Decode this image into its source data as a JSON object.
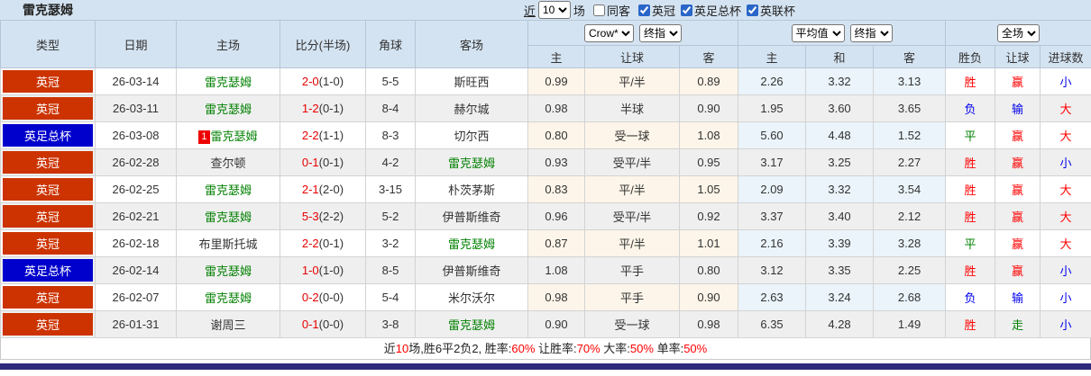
{
  "title": "雷克瑟姆",
  "controls": {
    "recent_label": "近",
    "recent_count": "10",
    "games_label": "场",
    "same_away": {
      "label": "同客",
      "checked": false
    },
    "leagues": [
      {
        "label": "英冠",
        "checked": true
      },
      {
        "label": "英足总杯",
        "checked": true
      },
      {
        "label": "英联杯",
        "checked": true
      }
    ]
  },
  "dropdowns": {
    "bookmaker": "Crow*",
    "asia_stage": "终指",
    "eu_source": "平均值",
    "eu_stage": "终指",
    "scope": "全场"
  },
  "columns": {
    "type": "类型",
    "date": "日期",
    "home": "主场",
    "score": "比分(半场)",
    "corner": "角球",
    "away": "客场",
    "asia_home": "主",
    "asia_line": "让球",
    "asia_away": "客",
    "eu_home": "主",
    "eu_draw": "和",
    "eu_away": "客",
    "res_spf": "胜负",
    "res_handicap": "让球",
    "res_goals": "进球数"
  },
  "colors": {
    "league_red": "#cc3300",
    "league_blue": "#0000cc",
    "team_highlight": "#008000",
    "score_red": "#e60000",
    "header_bg": "#d4e3f1",
    "asia_col_bg": "#fdf5e9",
    "eu_col_bg": "#eaf4fa",
    "bottom_bar": "#2f2a7b"
  },
  "rows": [
    {
      "league": "英冠",
      "league_color": "#cc3300",
      "date": "26-03-14",
      "home": {
        "name": "雷克瑟姆",
        "hl": true
      },
      "score": "2-0",
      "half": "(1-0)",
      "corner": "5-5",
      "away": {
        "name": "斯旺西",
        "hl": false
      },
      "asia": [
        "0.99",
        "平/半",
        "0.89"
      ],
      "europe": [
        "2.26",
        "3.32",
        "3.13"
      ],
      "results": [
        {
          "t": "胜",
          "c": "red"
        },
        {
          "t": "赢",
          "c": "red"
        },
        {
          "t": "小",
          "c": "blue"
        }
      ]
    },
    {
      "league": "英冠",
      "league_color": "#cc3300",
      "date": "26-03-11",
      "home": {
        "name": "雷克瑟姆",
        "hl": true
      },
      "score": "1-2",
      "half": "(0-1)",
      "corner": "8-4",
      "away": {
        "name": "赫尔城",
        "hl": false
      },
      "asia": [
        "0.98",
        "半球",
        "0.90"
      ],
      "europe": [
        "1.95",
        "3.60",
        "3.65"
      ],
      "results": [
        {
          "t": "负",
          "c": "blue"
        },
        {
          "t": "输",
          "c": "blue"
        },
        {
          "t": "大",
          "c": "red"
        }
      ]
    },
    {
      "league": "英足总杯",
      "league_color": "#0000cc",
      "date": "26-03-08",
      "home": {
        "name": "雷克瑟姆",
        "hl": true,
        "rank": "1"
      },
      "score": "2-2",
      "half": "(1-1)",
      "corner": "8-3",
      "away": {
        "name": "切尔西",
        "hl": false
      },
      "asia": [
        "0.80",
        "受一球",
        "1.08"
      ],
      "europe": [
        "5.60",
        "4.48",
        "1.52"
      ],
      "results": [
        {
          "t": "平",
          "c": "green"
        },
        {
          "t": "赢",
          "c": "red"
        },
        {
          "t": "大",
          "c": "red"
        }
      ]
    },
    {
      "league": "英冠",
      "league_color": "#cc3300",
      "date": "26-02-28",
      "home": {
        "name": "查尔顿",
        "hl": false
      },
      "score": "0-1",
      "half": "(0-1)",
      "corner": "4-2",
      "away": {
        "name": "雷克瑟姆",
        "hl": true
      },
      "asia": [
        "0.93",
        "受平/半",
        "0.95"
      ],
      "europe": [
        "3.17",
        "3.25",
        "2.27"
      ],
      "results": [
        {
          "t": "胜",
          "c": "red"
        },
        {
          "t": "赢",
          "c": "red"
        },
        {
          "t": "小",
          "c": "blue"
        }
      ]
    },
    {
      "league": "英冠",
      "league_color": "#cc3300",
      "date": "26-02-25",
      "home": {
        "name": "雷克瑟姆",
        "hl": true
      },
      "score": "2-1",
      "half": "(2-0)",
      "corner": "3-15",
      "away": {
        "name": "朴茨茅斯",
        "hl": false
      },
      "asia": [
        "0.83",
        "平/半",
        "1.05"
      ],
      "europe": [
        "2.09",
        "3.32",
        "3.54"
      ],
      "results": [
        {
          "t": "胜",
          "c": "red"
        },
        {
          "t": "赢",
          "c": "red"
        },
        {
          "t": "大",
          "c": "red"
        }
      ]
    },
    {
      "league": "英冠",
      "league_color": "#cc3300",
      "date": "26-02-21",
      "home": {
        "name": "雷克瑟姆",
        "hl": true
      },
      "score": "5-3",
      "half": "(2-2)",
      "corner": "5-2",
      "away": {
        "name": "伊普斯维奇",
        "hl": false
      },
      "asia": [
        "0.96",
        "受平/半",
        "0.92"
      ],
      "europe": [
        "3.37",
        "3.40",
        "2.12"
      ],
      "results": [
        {
          "t": "胜",
          "c": "red"
        },
        {
          "t": "赢",
          "c": "red"
        },
        {
          "t": "大",
          "c": "red"
        }
      ]
    },
    {
      "league": "英冠",
      "league_color": "#cc3300",
      "date": "26-02-18",
      "home": {
        "name": "布里斯托城",
        "hl": false
      },
      "score": "2-2",
      "half": "(0-1)",
      "corner": "3-2",
      "away": {
        "name": "雷克瑟姆",
        "hl": true
      },
      "asia": [
        "0.87",
        "平/半",
        "1.01"
      ],
      "europe": [
        "2.16",
        "3.39",
        "3.28"
      ],
      "results": [
        {
          "t": "平",
          "c": "green"
        },
        {
          "t": "赢",
          "c": "red"
        },
        {
          "t": "大",
          "c": "red"
        }
      ]
    },
    {
      "league": "英足总杯",
      "league_color": "#0000cc",
      "date": "26-02-14",
      "home": {
        "name": "雷克瑟姆",
        "hl": true
      },
      "score": "1-0",
      "half": "(1-0)",
      "corner": "8-5",
      "away": {
        "name": "伊普斯维奇",
        "hl": false
      },
      "asia": [
        "1.08",
        "平手",
        "0.80"
      ],
      "europe": [
        "3.12",
        "3.35",
        "2.25"
      ],
      "results": [
        {
          "t": "胜",
          "c": "red"
        },
        {
          "t": "赢",
          "c": "red"
        },
        {
          "t": "小",
          "c": "blue"
        }
      ]
    },
    {
      "league": "英冠",
      "league_color": "#cc3300",
      "date": "26-02-07",
      "home": {
        "name": "雷克瑟姆",
        "hl": true
      },
      "score": "0-2",
      "half": "(0-0)",
      "corner": "5-4",
      "away": {
        "name": "米尔沃尔",
        "hl": false
      },
      "asia": [
        "0.98",
        "平手",
        "0.90"
      ],
      "europe": [
        "2.63",
        "3.24",
        "2.68"
      ],
      "results": [
        {
          "t": "负",
          "c": "blue"
        },
        {
          "t": "输",
          "c": "blue"
        },
        {
          "t": "小",
          "c": "blue"
        }
      ]
    },
    {
      "league": "英冠",
      "league_color": "#cc3300",
      "date": "26-01-31",
      "home": {
        "name": "谢周三",
        "hl": false
      },
      "score": "0-1",
      "half": "(0-0)",
      "corner": "3-8",
      "away": {
        "name": "雷克瑟姆",
        "hl": true
      },
      "asia": [
        "0.90",
        "受一球",
        "0.98"
      ],
      "europe": [
        "6.35",
        "4.28",
        "1.49"
      ],
      "results": [
        {
          "t": "胜",
          "c": "red"
        },
        {
          "t": "走",
          "c": "green"
        },
        {
          "t": "小",
          "c": "blue"
        }
      ]
    }
  ],
  "summary": {
    "parts": [
      {
        "text": "近",
        "c": "dark"
      },
      {
        "text": "10",
        "c": "red"
      },
      {
        "text": "场,胜6平2负2, 胜率:",
        "c": "dark"
      },
      {
        "text": "60%",
        "c": "red"
      },
      {
        "text": " 让胜率:",
        "c": "dark"
      },
      {
        "text": "70%",
        "c": "red"
      },
      {
        "text": " 大率:",
        "c": "dark"
      },
      {
        "text": "50%",
        "c": "red"
      },
      {
        "text": " 单率:",
        "c": "dark"
      },
      {
        "text": "50%",
        "c": "red"
      }
    ]
  }
}
